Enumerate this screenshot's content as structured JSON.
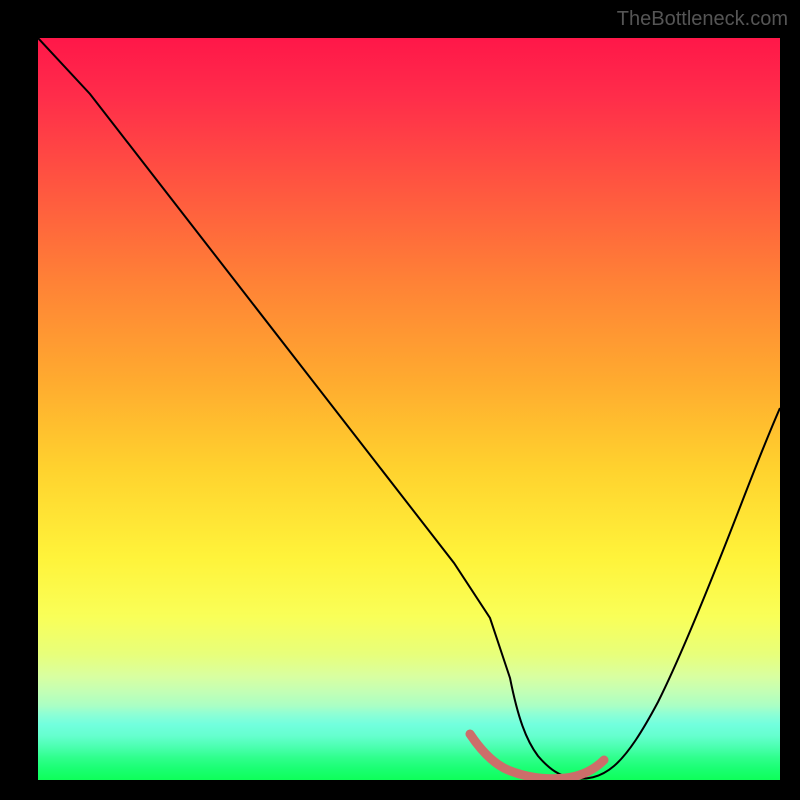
{
  "watermark": "TheBottleneck.com",
  "chart_data": {
    "type": "line",
    "title": "",
    "xlabel": "",
    "ylabel": "",
    "xlim": [
      0,
      100
    ],
    "ylim": [
      0,
      100
    ],
    "grid": false,
    "series": [
      {
        "name": "bottleneck-curve",
        "x": [
          0,
          6,
          12,
          18,
          24,
          30,
          36,
          42,
          48,
          54,
          58,
          60,
          64,
          68,
          72,
          76,
          80,
          84,
          88,
          92,
          96,
          100
        ],
        "y": [
          100,
          92,
          83,
          74,
          65,
          56,
          47,
          38,
          29,
          20,
          12,
          8,
          2,
          0,
          0,
          3,
          9,
          17,
          26,
          35,
          45,
          55
        ]
      }
    ],
    "annotations": [
      {
        "name": "optimal-range-marker",
        "x_start": 58,
        "x_end": 75,
        "y": 1
      }
    ]
  }
}
